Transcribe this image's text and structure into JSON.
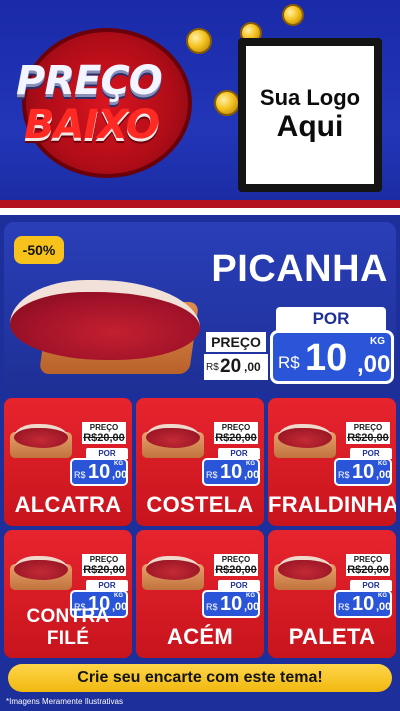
{
  "header": {
    "badge_word_top": "PREÇO",
    "badge_word_bottom": "BAIXO",
    "logo_line1": "Sua Logo",
    "logo_line2": "Aqui"
  },
  "featured": {
    "discount": "-50%",
    "name": "PICANHA",
    "por_label": "POR",
    "currency": "R$",
    "price_int": "10",
    "price_dec": ",00",
    "unit": "KG",
    "preco_label": "PREÇO",
    "old_currency": "R$",
    "old_int": "20",
    "old_dec": ",00"
  },
  "products": [
    {
      "name": "ALCATRA",
      "preco_label": "PREÇO",
      "old_price": "R$20,00",
      "por_label": "POR",
      "currency": "R$",
      "price_int": "10",
      "price_dec": ",00",
      "unit": "KG"
    },
    {
      "name": "COSTELA",
      "preco_label": "PREÇO",
      "old_price": "R$20,00",
      "por_label": "POR",
      "currency": "R$",
      "price_int": "10",
      "price_dec": ",00",
      "unit": "KG"
    },
    {
      "name": "FRALDINHA",
      "preco_label": "PREÇO",
      "old_price": "R$20,00",
      "por_label": "POR",
      "currency": "R$",
      "price_int": "10",
      "price_dec": ",00",
      "unit": "KG"
    },
    {
      "name": "CONTRA FILÉ",
      "preco_label": "PREÇO",
      "old_price": "R$20,00",
      "por_label": "POR",
      "currency": "R$",
      "price_int": "10",
      "price_dec": ",00",
      "unit": "KG"
    },
    {
      "name": "ACÉM",
      "preco_label": "PREÇO",
      "old_price": "R$20,00",
      "por_label": "POR",
      "currency": "R$",
      "price_int": "10",
      "price_dec": ",00",
      "unit": "KG"
    },
    {
      "name": "PALETA",
      "preco_label": "PREÇO",
      "old_price": "R$20,00",
      "por_label": "POR",
      "currency": "R$",
      "price_int": "10",
      "price_dec": ",00",
      "unit": "KG"
    }
  ],
  "footer": {
    "cta": "Crie seu encarte com este tema!",
    "disclaimer": "*Imagens Meramente Ilustrativas"
  },
  "colors": {
    "background": "#1c2f9a",
    "card_red": "#e7242e",
    "price_blue": "#2a55d8",
    "accent_yellow": "#f6c21b"
  }
}
